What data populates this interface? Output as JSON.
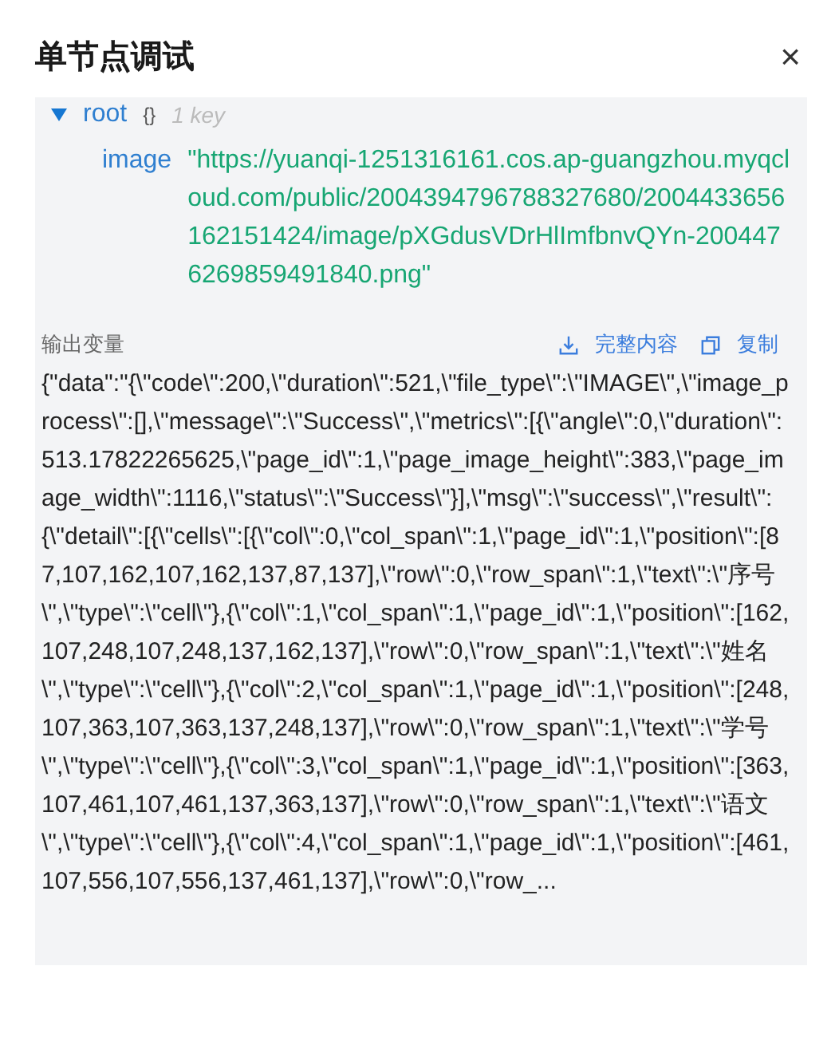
{
  "dialog": {
    "title": "单节点调试",
    "close": "×"
  },
  "tree": {
    "key": "root",
    "expanded": true,
    "type_badge": "{}",
    "count": "1 key",
    "children": [
      {
        "key": "image",
        "value": "\"https://yuanqi-1251316161.cos.ap-guangzhou.myqcloud.com/public/2004394796788327680/2004433656162151424/image/pXGdusVDrHlImfbnvQYn-2004476269859491840.png\""
      }
    ]
  },
  "output": {
    "label": "输出变量",
    "actions": [
      {
        "kind": "download",
        "label": "完整内容"
      },
      {
        "kind": "copy",
        "label": "复制"
      }
    ],
    "text": "{\"data\":\"{\\\"code\\\":200,\\\"duration\\\":521,\\\"file_type\\\":\\\"IMAGE\\\",\\\"image_process\\\":[],\\\"message\\\":\\\"Success\\\",\\\"metrics\\\":[{\\\"angle\\\":0,\\\"duration\\\":513.17822265625,\\\"page_id\\\":1,\\\"page_image_height\\\":383,\\\"page_image_width\\\":1116,\\\"status\\\":\\\"Success\\\"}],\\\"msg\\\":\\\"success\\\",\\\"result\\\":{\\\"detail\\\":[{\\\"cells\\\":[{\\\"col\\\":0,\\\"col_span\\\":1,\\\"page_id\\\":1,\\\"position\\\":[87,107,162,107,162,137,87,137],\\\"row\\\":0,\\\"row_span\\\":1,\\\"text\\\":\\\"序号\\\",\\\"type\\\":\\\"cell\\\"},{\\\"col\\\":1,\\\"col_span\\\":1,\\\"page_id\\\":1,\\\"position\\\":[162,107,248,107,248,137,162,137],\\\"row\\\":0,\\\"row_span\\\":1,\\\"text\\\":\\\"姓名\\\",\\\"type\\\":\\\"cell\\\"},{\\\"col\\\":2,\\\"col_span\\\":1,\\\"page_id\\\":1,\\\"position\\\":[248,107,363,107,363,137,248,137],\\\"row\\\":0,\\\"row_span\\\":1,\\\"text\\\":\\\"学号\\\",\\\"type\\\":\\\"cell\\\"},{\\\"col\\\":3,\\\"col_span\\\":1,\\\"page_id\\\":1,\\\"position\\\":[363,107,461,107,461,137,363,137],\\\"row\\\":0,\\\"row_span\\\":1,\\\"text\\\":\\\"语文\\\",\\\"type\\\":\\\"cell\\\"},{\\\"col\\\":4,\\\"col_span\\\":1,\\\"page_id\\\":1,\\\"position\\\":[461,107,556,107,556,137,461,137],\\\"row\\\":0,\\\"row_..."
  }
}
